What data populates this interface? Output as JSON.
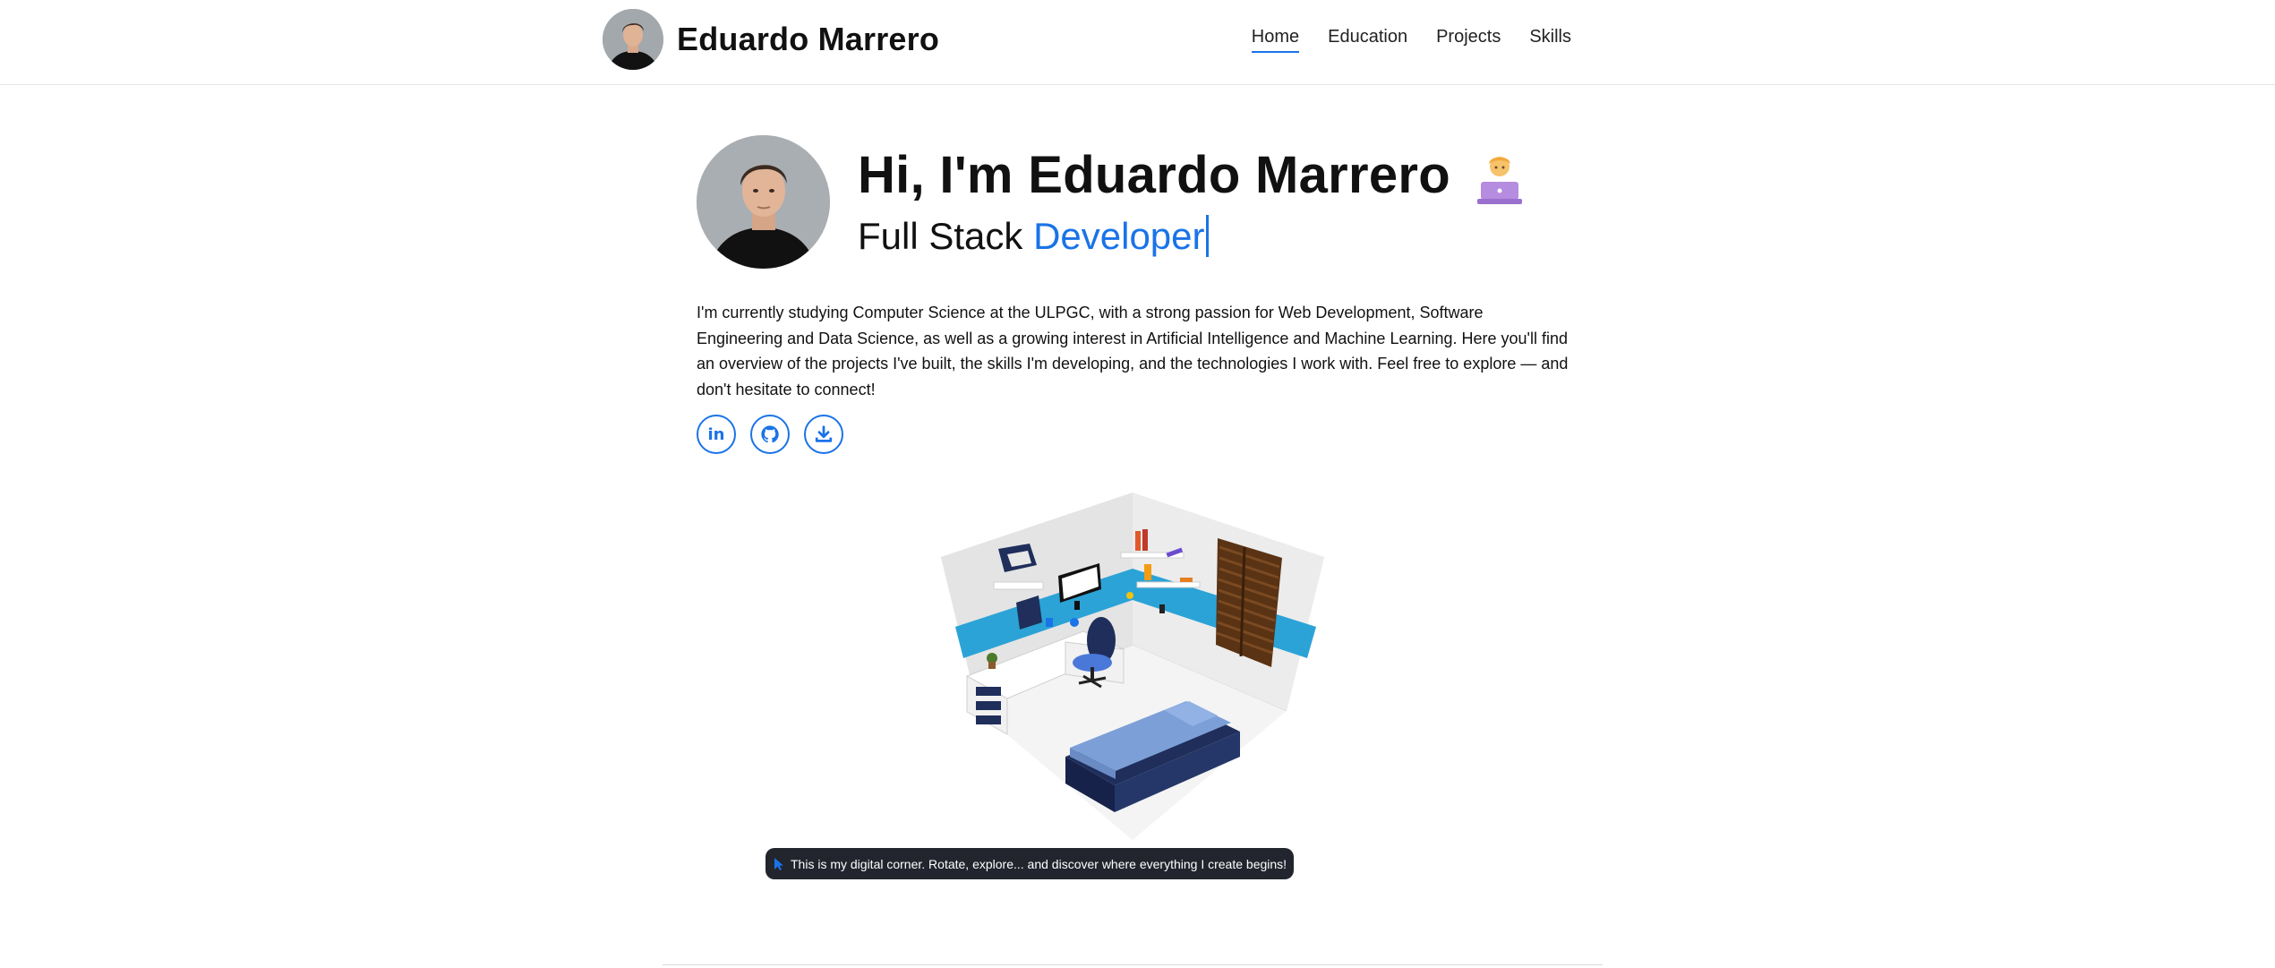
{
  "header": {
    "brand_name": "Eduardo Marrero",
    "nav": [
      {
        "label": "Home",
        "active": true
      },
      {
        "label": "Education",
        "active": false
      },
      {
        "label": "Projects",
        "active": false
      },
      {
        "label": "Skills",
        "active": false
      }
    ]
  },
  "hero": {
    "title": "Hi, I'm Eduardo Marrero",
    "title_emoji": "technologist-icon",
    "subtitle_prefix": "Full Stack",
    "subtitle_accent": "Developer",
    "intro": "I'm currently studying Computer Science at the ULPGC, with a strong passion for Web Development, Software Engineering and Data Science, as well as a growing interest in Artificial Intelligence and Machine Learning. Here you'll find an overview of the projects I've built, the skills I'm developing, and the technologies I work with. Feel free to explore — and don't hesitate to connect!",
    "socials": [
      {
        "icon": "linkedin-icon",
        "glyph": "in"
      },
      {
        "icon": "github-icon"
      },
      {
        "icon": "download-icon"
      }
    ]
  },
  "room": {
    "caption": "This is my digital corner. Rotate, explore... and discover where everything I create begins!"
  },
  "colors": {
    "accent": "#1a73e8",
    "caption_bg": "#22252e",
    "wall_stripe": "#2ba3d6",
    "bed_blue": "#7d9fd8",
    "navy": "#1f2e5a"
  }
}
